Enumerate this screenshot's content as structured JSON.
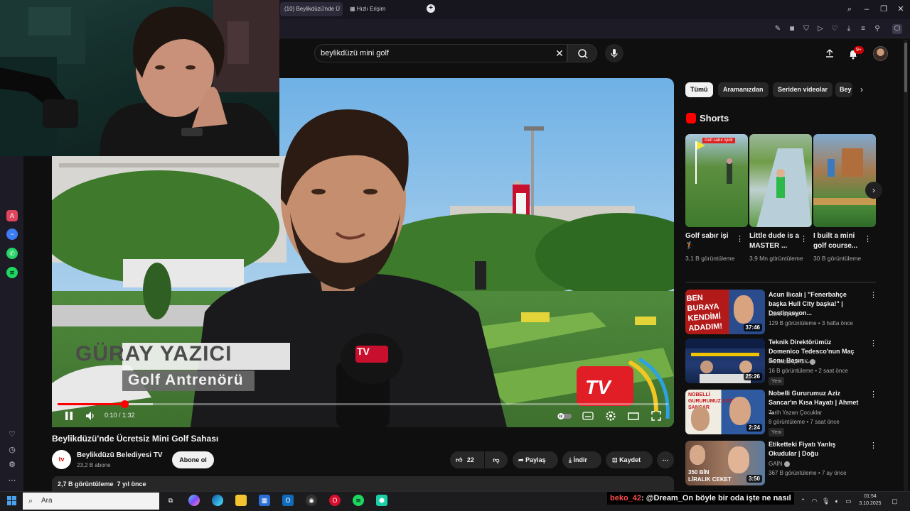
{
  "browser": {
    "active_tab": "(10) Beylikdüzü'nde Ü",
    "second_tab": "Hızlı Erişim"
  },
  "search": {
    "query": "beylikdüzü mini golf"
  },
  "header": {
    "notifications": "9+"
  },
  "player": {
    "name_overlay": "GÜRAY YAZICI",
    "role_overlay": "Golf Antrenörü",
    "logo_text": "TV",
    "time": "0:10 / 1:32",
    "progress": 0.109
  },
  "video": {
    "title": "Beylikdüzü'nde Ücretsiz Mini Golf Sahası",
    "channel": "Beylikdüzü Belediyesi TV",
    "channel_avatar": "tv",
    "subscribers": "23,2 B abone",
    "subscribe": "Abone ol",
    "likes": "22",
    "share": "Paylaş",
    "download": "İndir",
    "save": "Kaydet",
    "views_date": "2,7 B görüntüleme  7 yıl önce"
  },
  "chips": [
    "Tümü",
    "Aramanızdan",
    "Seriden videolar",
    "Bey"
  ],
  "shorts": {
    "heading": "Shorts",
    "items": [
      {
        "title": "Golf sabır işi 🏌",
        "views": "3,1 B görüntüleme",
        "thumb_text": "Golf sabır işidir"
      },
      {
        "title": "Little dude is a MASTER ...",
        "views": "3,9 Mn görüntüleme"
      },
      {
        "title": "I built a mini golf course...",
        "views": "30 B görüntüleme"
      }
    ]
  },
  "recommendations": [
    {
      "title": "Acun Ilıcalı | \"Fenerbahçe başka Hull City başka!\" | Destinasyon...",
      "channel": "Libre Sports",
      "meta": "129 B görüntüleme • 3 hafta önce",
      "duration": "37:46",
      "thumb_text": "BEN BURAYA KENDİMİ ADADIM!",
      "badge": ""
    },
    {
      "title": "Teknik Direktörümüz Domenico Tedesco'nun Maç Sonu Basın ...",
      "channel": "Fenerbahçe SK",
      "meta": "16 B görüntüleme • 2 saat önce",
      "duration": "25:26",
      "thumb_text": "",
      "badge": "Yeni"
    },
    {
      "title": "Nobelli Gururumuz Aziz Sancar'ın Kısa Hayatı | Ahmet ...",
      "channel": "Tarih Yazan Çocuklar",
      "meta": "8 görüntüleme • 7 saat önce",
      "duration": "2:24",
      "thumb_text": "NOBELLİ GURURUMUZ AZİZ SANCAR",
      "badge": "Yeni"
    },
    {
      "title": "Etiketteki Fiyatı Yanlış Okudular | Doğu",
      "channel": "GAİN",
      "meta": "367 B görüntüleme • 7 ay önce",
      "duration": "3:50",
      "thumb_text": "350 BİN LİRALIK CEKET",
      "badge": ""
    }
  ],
  "taskbar": {
    "search": "Ara",
    "chat_user": "beko_42",
    "chat_text": ": @Dream_On böyle bir oda işte ne nasıl",
    "time": "01:54",
    "date": "3.10.2025"
  }
}
